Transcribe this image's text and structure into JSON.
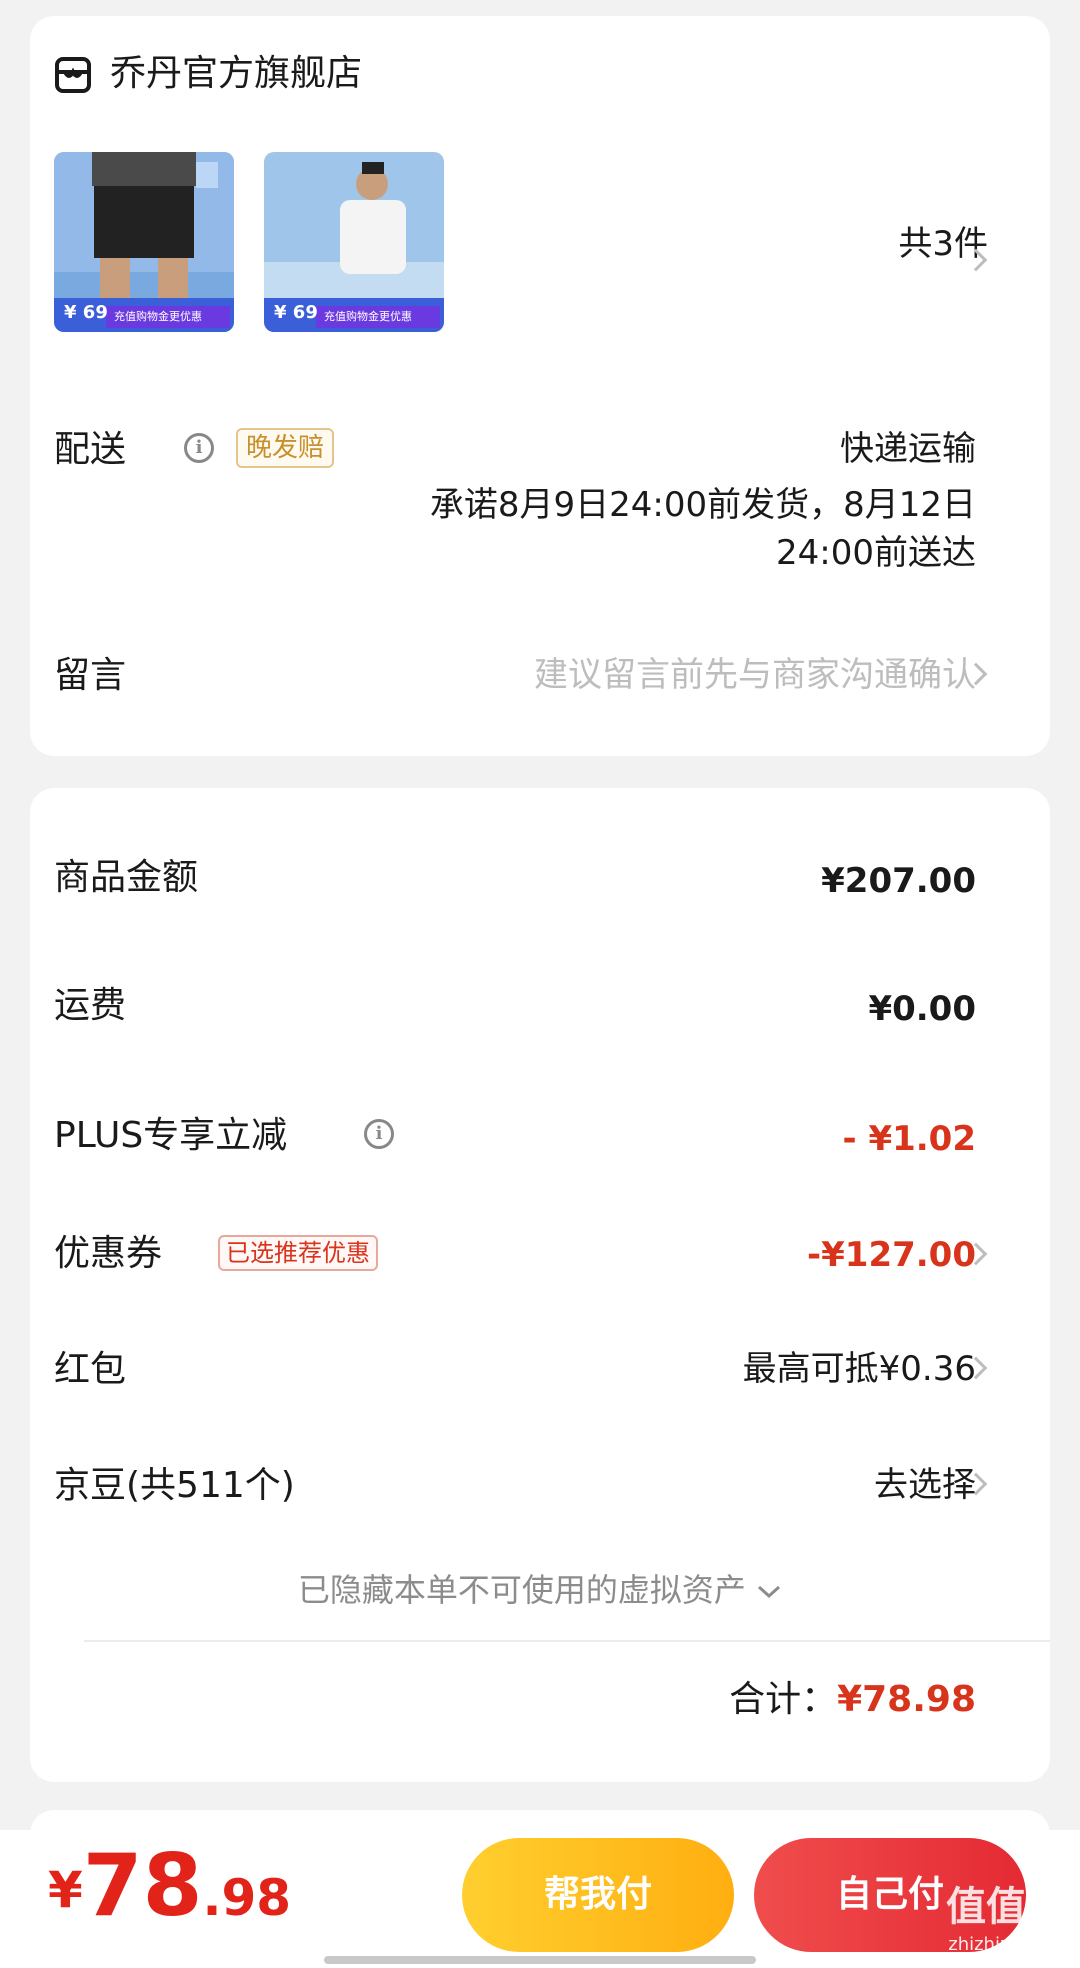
{
  "store": {
    "name": "乔丹官方旗舰店",
    "item_count": "共3件"
  },
  "products": [
    {
      "badge_price": "69",
      "banner": "充值购物金更优惠"
    },
    {
      "badge_price": "69",
      "banner": "充值购物金更优惠"
    }
  ],
  "delivery": {
    "label": "配送",
    "tag": "晚发赔",
    "method": "快递运输",
    "promise_line1": "承诺8月9日24:00前发货，8月12日",
    "promise_line2": "24:00前送达"
  },
  "message": {
    "label": "留言",
    "placeholder": "建议留言前先与商家沟通确认"
  },
  "summary": {
    "goods_label": "商品金额",
    "goods_value": "¥207.00",
    "shipping_label": "运费",
    "shipping_value": "¥0.00",
    "plus_label": "PLUS专享立减",
    "plus_value": "- ¥1.02",
    "coupon_label": "优惠券",
    "coupon_tag": "已选推荐优惠",
    "coupon_value": "-¥127.00",
    "redpack_label": "红包",
    "redpack_value": "最高可抵¥0.36",
    "jingdou_label": "京豆(共511个)",
    "jingdou_value": "去选择",
    "hidden_assets": "已隐藏本单不可使用的虚拟资产",
    "total_label": "合计：",
    "total_value": "¥78.98"
  },
  "bottom": {
    "currency": "¥",
    "price_int": "78",
    "price_dec": ".98",
    "help_pay": "帮我付",
    "self_pay": "自己付"
  },
  "watermark": {
    "text": "值值值",
    "sub": "zhizhizhi.com"
  },
  "colors": {
    "accent_red": "#d8341c",
    "price_red": "#e2231a",
    "help_btn": "#ffbf1f",
    "self_btn": "#e93a40"
  }
}
